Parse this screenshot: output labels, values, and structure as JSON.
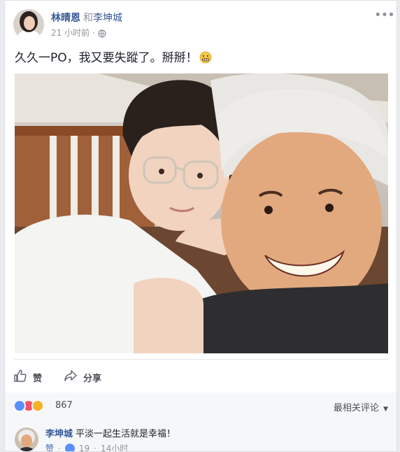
{
  "post": {
    "author": "林晴恩",
    "with_prefix": "和",
    "tagged": "李坤城",
    "timestamp": "21 小时前",
    "separator": "·",
    "audience_icon": "globe-icon",
    "text": "久久一PO，我又要失蹤了。掰掰！",
    "text_emoji": "grimacing-face-emoji",
    "menu_icon": "more-options-icon"
  },
  "actions": {
    "like_label": "赞",
    "share_label": "分享"
  },
  "reactions": {
    "icons": [
      "like",
      "love",
      "haha"
    ],
    "count": "867",
    "sort_label": "最相关评论"
  },
  "comment": {
    "author": "李坤城",
    "text": "平淡一起生活就是幸福！",
    "like_label": "赞",
    "separator": "·",
    "like_count": "19",
    "time": "14小时"
  },
  "colors": {
    "link": "#365899",
    "muted": "#90949c",
    "like_blue": "#5890ff",
    "love_red": "#f25268",
    "haha_yellow": "#f7b125"
  }
}
